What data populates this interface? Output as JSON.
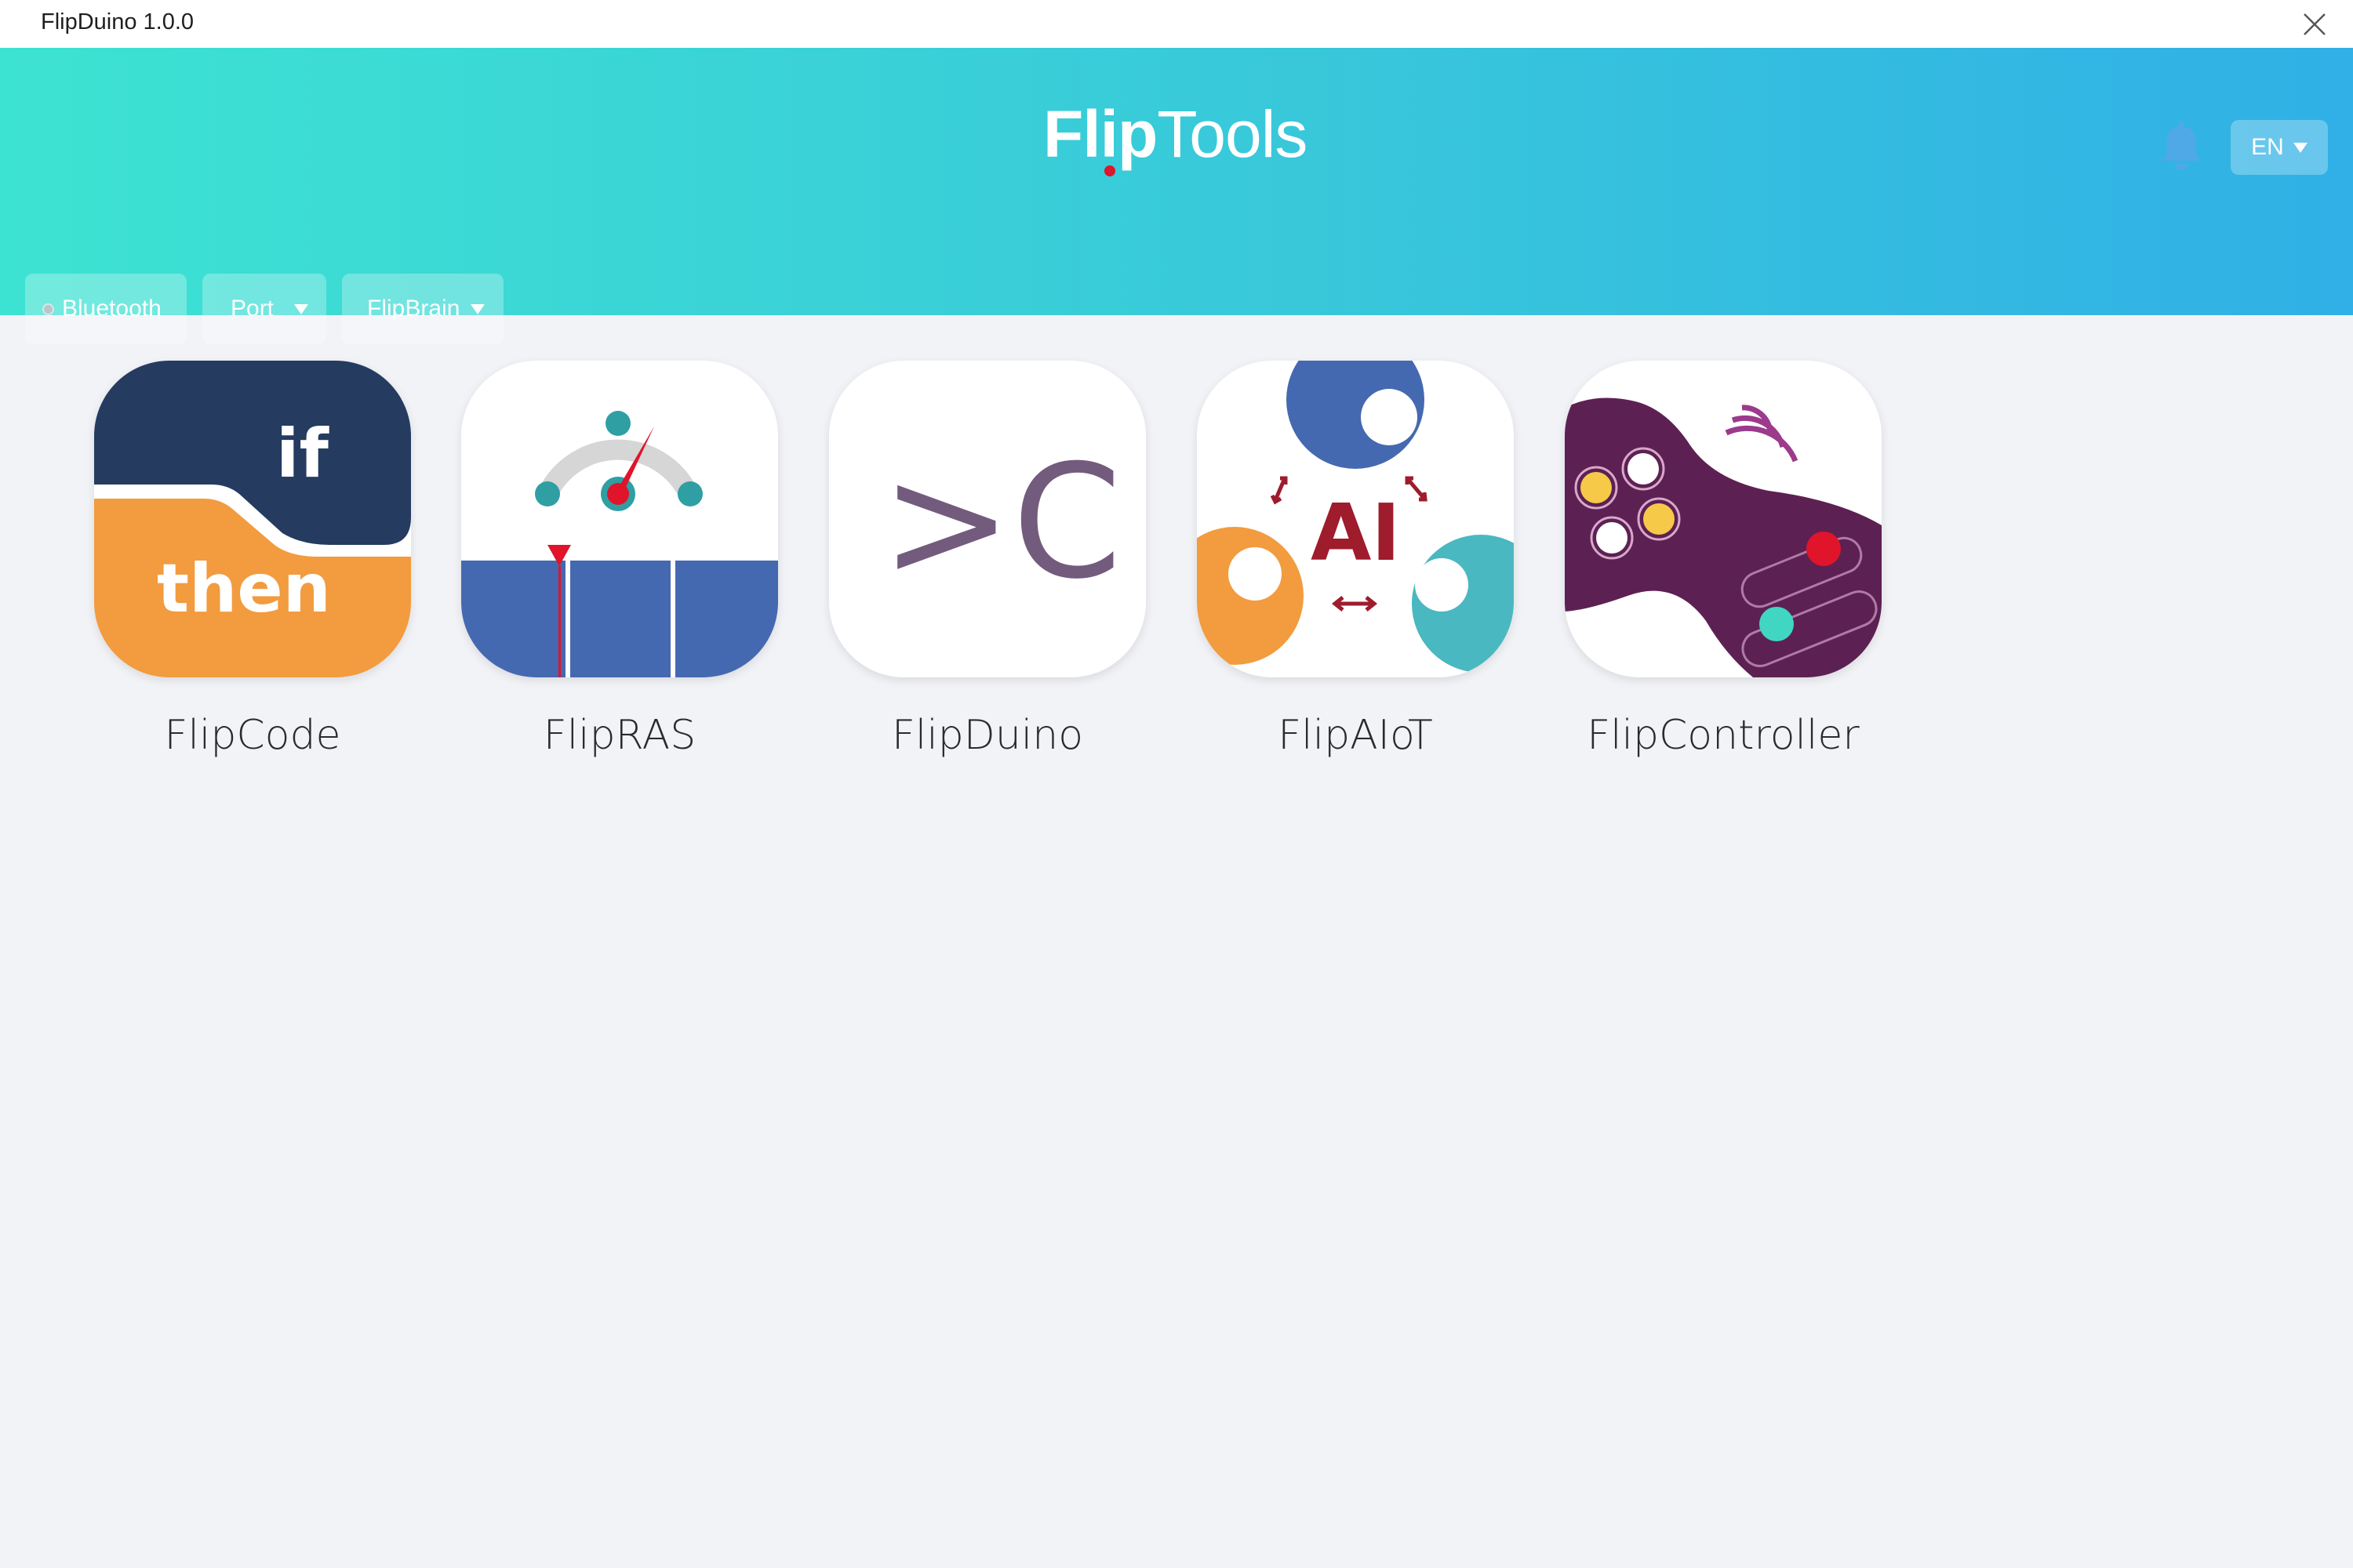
{
  "window": {
    "title": "FlipDuino 1.0.0"
  },
  "header": {
    "logo_bold": "Flip",
    "logo_light": "Tools",
    "language": "EN"
  },
  "connection": {
    "bluetooth_label": "Bluetooth",
    "port_label": "Port",
    "device_label": "FlipBrain"
  },
  "apps": [
    {
      "name": "FlipCode",
      "icon": "if-then-icon",
      "icon_text_1": "if",
      "icon_text_2": "then"
    },
    {
      "name": "FlipRAS",
      "icon": "gauge-icon"
    },
    {
      "name": "FlipDuino",
      "icon": "terminal-c-icon",
      "icon_text": ">C"
    },
    {
      "name": "FlipAIoT",
      "icon": "ai-icon",
      "icon_text": "AI"
    },
    {
      "name": "FlipController",
      "icon": "gamepad-icon"
    }
  ],
  "colors": {
    "header_start": "#3de3d2",
    "header_end": "#30b0e6",
    "background": "#f2f3f7",
    "flipcode_navy": "#253b60",
    "flipcode_orange": "#f29b3f",
    "fliprase_blue": "#4569b0",
    "flipduino_purple": "#735b7e",
    "flipaiot_red": "#9e1c2c",
    "flipcontroller_purple": "#5c2152"
  }
}
